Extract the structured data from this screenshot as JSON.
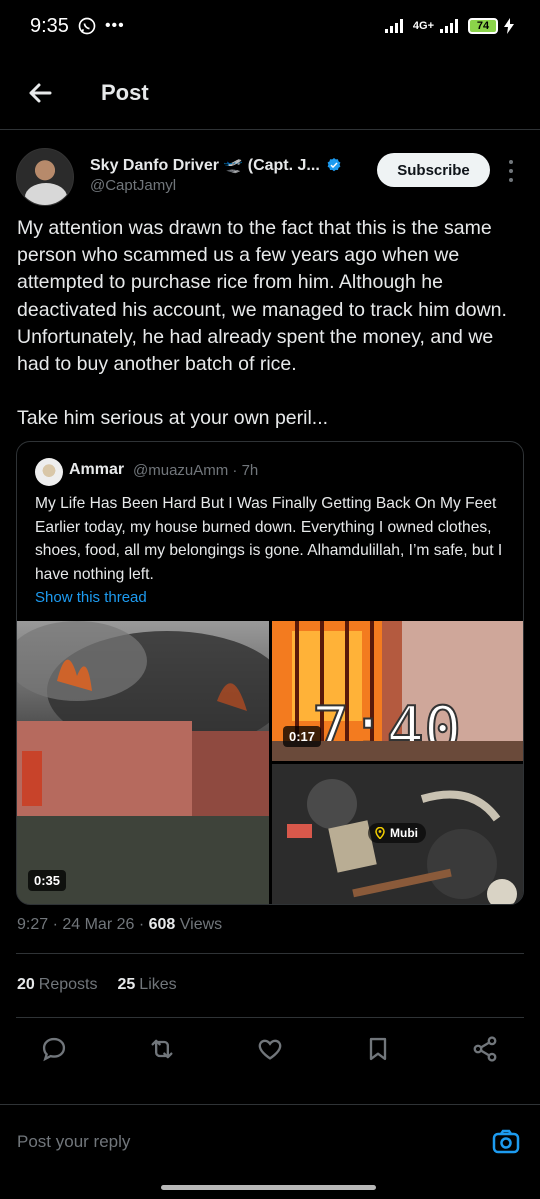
{
  "status_bar": {
    "time": "9:35",
    "network": "4G+",
    "battery": "74"
  },
  "header": {
    "title": "Post"
  },
  "post": {
    "author_name": "Sky Danfo Driver 🛫 (Capt. J...",
    "author_handle": "@CaptJamyl",
    "subscribe_label": "Subscribe",
    "text": "My attention was drawn to the fact that this is the same person who scammed us a few years ago when we attempted to purchase rice from him. Although he deactivated his account, we managed to track him down. Unfortunately, he had already spent the money, and we had to buy another batch of rice.\n\nTake him serious at your own peril...",
    "time": "9:27",
    "date": "24 Mar 26",
    "views_count": "608",
    "views_label": "Views",
    "reposts_count": "20",
    "reposts_label": "Reposts",
    "likes_count": "25",
    "likes_label": "Likes"
  },
  "quote": {
    "name": "Ammar",
    "handle_time": "@muazuAmm · 7h",
    "text": "My Life Has Been Hard But I Was Finally Getting Back On My Feet Earlier today, my house burned down. Everything I owned clothes, shoes, food, all my belongings is gone. Alhamdulillah, I’m safe, but I have nothing left.",
    "show_thread": "Show this thread",
    "media": [
      {
        "duration": "0:35"
      },
      {
        "duration": "0:17",
        "overlay_text": "7:40"
      },
      {
        "location_tag": "Mubi"
      }
    ]
  },
  "actions": {
    "icons": [
      "reply-icon",
      "repost-icon",
      "like-icon",
      "bookmark-icon",
      "share-icon"
    ]
  },
  "reply_bar": {
    "placeholder": "Post your reply"
  },
  "colors": {
    "background": "#000000",
    "accent": "#1d9bf0",
    "text": "#e7e9ea",
    "muted": "#71767b",
    "border": "#2f3336"
  }
}
